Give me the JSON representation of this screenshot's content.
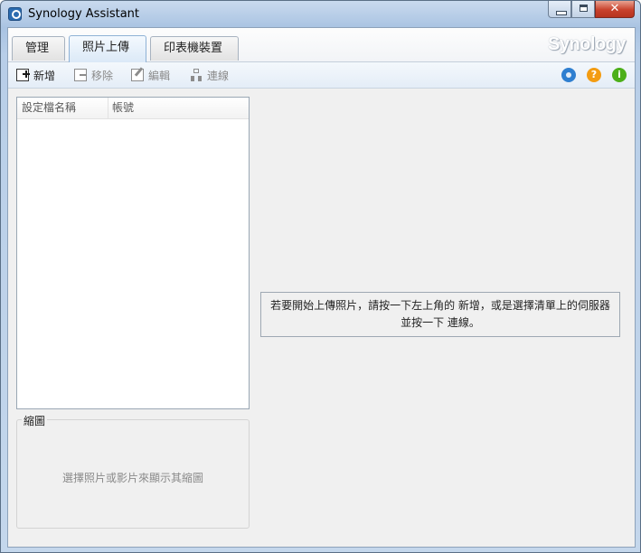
{
  "window": {
    "title": "Synology Assistant",
    "controls": {
      "minimize": "",
      "maximize": "",
      "close": "✕"
    }
  },
  "brand": "Synology",
  "tabs": [
    {
      "label": "管理",
      "active": false
    },
    {
      "label": "照片上傳",
      "active": true
    },
    {
      "label": "印表機裝置",
      "active": false
    }
  ],
  "toolbar": {
    "add_label": "新增",
    "remove_label": "移除",
    "edit_label": "編輯",
    "connect_label": "連線",
    "icons": [
      "gear-icon",
      "help-icon",
      "info-icon"
    ],
    "help_glyph": "?",
    "info_glyph": "i"
  },
  "list": {
    "columns": [
      "設定檔名稱",
      "帳號"
    ],
    "rows": []
  },
  "thumbnail": {
    "legend": "縮圖",
    "hint": "選擇照片或影片來顯示其縮圖"
  },
  "message": {
    "text": "若要開始上傳照片，請按一下左上角的 新增，或是選擇清單上的伺服器並按一下 連線。"
  },
  "colors": {
    "accent": "#2f7fd0",
    "help": "#f39c12",
    "info": "#4caf1a",
    "close": "#c8412c"
  }
}
